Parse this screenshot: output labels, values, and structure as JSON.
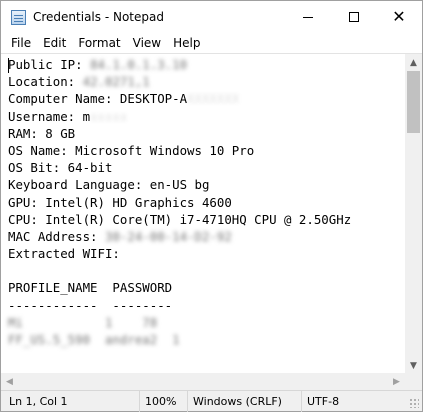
{
  "window": {
    "title": "Credentials - Notepad",
    "icon": "notepad-icon"
  },
  "menu": [
    "File",
    "Edit",
    "Format",
    "View",
    "Help"
  ],
  "lines": [
    {
      "label": "Public IP: ",
      "value": "84.1.0.1.3.10",
      "redacted": true
    },
    {
      "label": "Location: ",
      "value": "42.0271,1",
      "redacted": true
    },
    {
      "label": "Computer Name: ",
      "value": "DESKTOP-A",
      "redacted_tail": "XXXXXXX"
    },
    {
      "label": "Username: ",
      "value": "m",
      "redacted_tail": "xxxxx"
    },
    {
      "label": "RAM: 8 GB",
      "value": ""
    },
    {
      "label": "OS Name: Microsoft Windows 10 Pro",
      "value": ""
    },
    {
      "label": "OS Bit: 64-bit",
      "value": ""
    },
    {
      "label": "Keyboard Language: en-US bg",
      "value": ""
    },
    {
      "label": "GPU: Intel(R) HD Graphics 4600",
      "value": ""
    },
    {
      "label": "CPU: Intel(R) Core(TM) i7-4710HQ CPU @ 2.50GHz",
      "value": ""
    },
    {
      "label": "MAC Address: ",
      "value": "30-24-00-14-D2-92",
      "redacted": true
    },
    {
      "label": "Extracted WIFI:",
      "value": ""
    },
    {
      "label": "",
      "value": ""
    },
    {
      "label": "PROFILE_NAME  PASSWORD",
      "value": ""
    },
    {
      "label": "------------  --------",
      "value": ""
    },
    {
      "label": "",
      "value": "Mi           1    78",
      "redacted": true
    },
    {
      "label": "",
      "value": "FF_US.5_590  andrea2  1",
      "redacted": true
    }
  ],
  "statusbar": {
    "position": "Ln 1, Col 1",
    "zoom": "100%",
    "line_ending": "Windows (CRLF)",
    "encoding": "UTF-8"
  }
}
